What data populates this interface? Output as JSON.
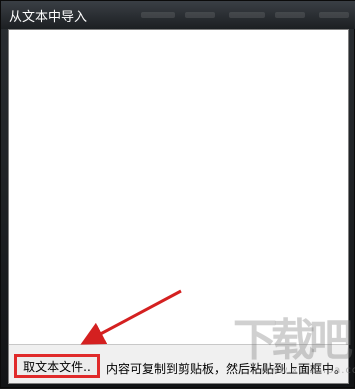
{
  "window": {
    "title": "从文本中导入"
  },
  "bottom_bar": {
    "read_file_button": "取文本文件..",
    "hint_text": "内容可复制到剪贴板，然后粘贴到上面框中。"
  },
  "colors": {
    "highlight_border": "#e02a2a",
    "arrow": "#d42020"
  },
  "watermark": {
    "logo_text": "下载吧",
    "url_text": "www.xiazaiba.com"
  }
}
